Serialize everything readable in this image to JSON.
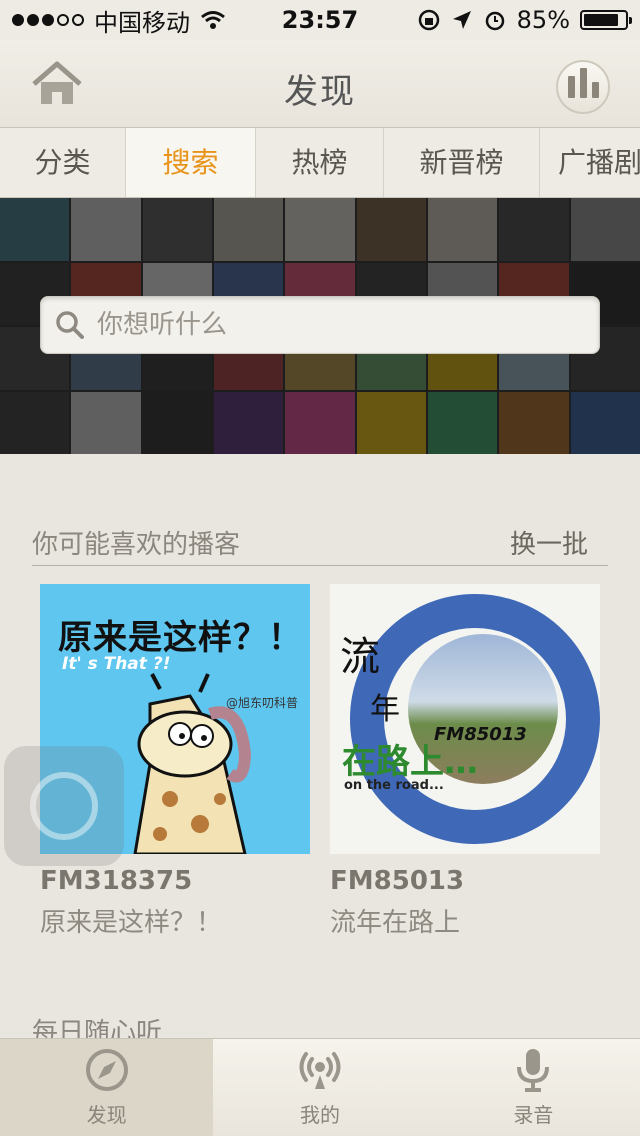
{
  "status_bar": {
    "carrier": "中国移动",
    "time": "23:57",
    "battery": "85%",
    "battery_level": 0.85
  },
  "nav": {
    "title": "发现",
    "home_icon": "home-icon",
    "right_icon": "equalizer-icon"
  },
  "tabs": [
    {
      "label": "分类"
    },
    {
      "label": "搜索"
    },
    {
      "label": "热榜"
    },
    {
      "label": "新晋榜"
    },
    {
      "label": "广播剧"
    }
  ],
  "search": {
    "placeholder": "你想听什么"
  },
  "recommend": {
    "title": "你可能喜欢的播客",
    "action": "换一批",
    "items": [
      {
        "id": "FM318375",
        "name": "原来是这样？！",
        "cover_text": "原来是这样？！",
        "cover_sub": "It' s That ?!",
        "cover_credit": "@旭东叨科普"
      },
      {
        "id": "FM85013",
        "name": "流年在路上",
        "cover_t1": "流",
        "cover_t2": "年",
        "cover_t3": "在路上…",
        "cover_code": "FM85013",
        "cover_road": "on the road..."
      }
    ]
  },
  "daily": {
    "title": "每日随心听"
  },
  "tab_bar": [
    {
      "label": "发现",
      "icon": "compass-icon"
    },
    {
      "label": "我的",
      "icon": "broadcast-icon"
    },
    {
      "label": "录音",
      "icon": "microphone-icon"
    }
  ],
  "colors": {
    "accent": "#e8941a",
    "background": "#e9e6df"
  }
}
